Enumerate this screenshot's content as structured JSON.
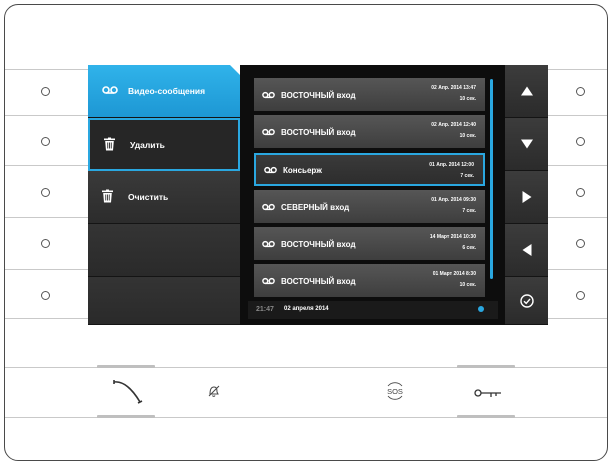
{
  "menu": {
    "items": [
      {
        "label": "Видео-сообщения",
        "icon": "voicemail-icon",
        "state": "active"
      },
      {
        "label": "Удалить",
        "icon": "trash-icon",
        "state": "selected"
      },
      {
        "label": "Очистить",
        "icon": "trash-icon",
        "state": "normal"
      }
    ]
  },
  "messages": [
    {
      "name": "ВОСТОЧНЫЙ вход",
      "date": "02 Апр. 2014 13:47",
      "duration": "10 сек.",
      "highlighted": false
    },
    {
      "name": "ВОСТОЧНЫЙ вход",
      "date": "02 Апр. 2014 12:40",
      "duration": "10 сек.",
      "highlighted": false
    },
    {
      "name": "Консьерж",
      "date": "01 Апр. 2014 12:00",
      "duration": "7 сек.",
      "highlighted": true
    },
    {
      "name": "СЕВЕРНЫЙ вход",
      "date": "01 Апр. 2014 09:30",
      "duration": "7 сек.",
      "highlighted": false
    },
    {
      "name": "ВОСТОЧНЫЙ вход",
      "date": "14 Март 2014 10:30",
      "duration": "6 сек.",
      "highlighted": false
    },
    {
      "name": "ВОСТОЧНЫЙ вход",
      "date": "01 Март 2014 8:30",
      "duration": "10 сек.",
      "highlighted": false
    }
  ],
  "status": {
    "time": "21:47",
    "date": "02 апреля 2014"
  },
  "nav": [
    "arrow-up-icon",
    "arrow-down-icon",
    "arrow-right-icon",
    "arrow-left-icon",
    "confirm-icon"
  ],
  "bottom_bar": [
    "handset-icon",
    "bell-off-icon",
    "sos-icon",
    "key-icon"
  ],
  "bottom_labels": {
    "sos": "SOS"
  },
  "colors": {
    "accent": "#2aa7e0",
    "panel": "#262626",
    "screen": "#0d0d0d"
  }
}
